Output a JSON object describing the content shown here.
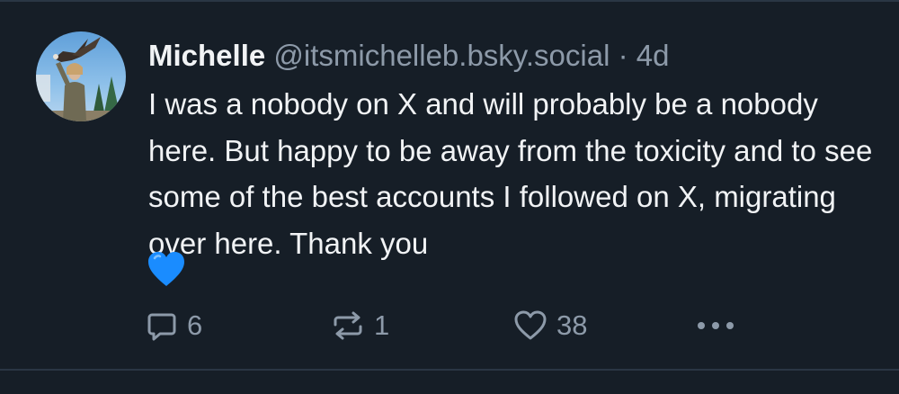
{
  "post": {
    "author": {
      "display_name": "Michelle",
      "handle": "@itsmichelleb.bsky.social"
    },
    "separator": "·",
    "timestamp": "4d",
    "text": "I was a nobody on X and will probably be a nobody here. But happy to be away from the toxicity and to see some of the best accounts I followed on X, migrating over here. Thank you",
    "emoji": "blue-heart",
    "actions": {
      "replies": "6",
      "reposts": "1",
      "likes": "38"
    }
  },
  "colors": {
    "background": "#161e27",
    "text": "#f1f3f5",
    "muted": "#8d9aa9",
    "divider": "#2a3644",
    "heart": "#1a8cff"
  },
  "icons": [
    "reply-icon",
    "repost-icon",
    "like-icon",
    "more-options-icon"
  ]
}
